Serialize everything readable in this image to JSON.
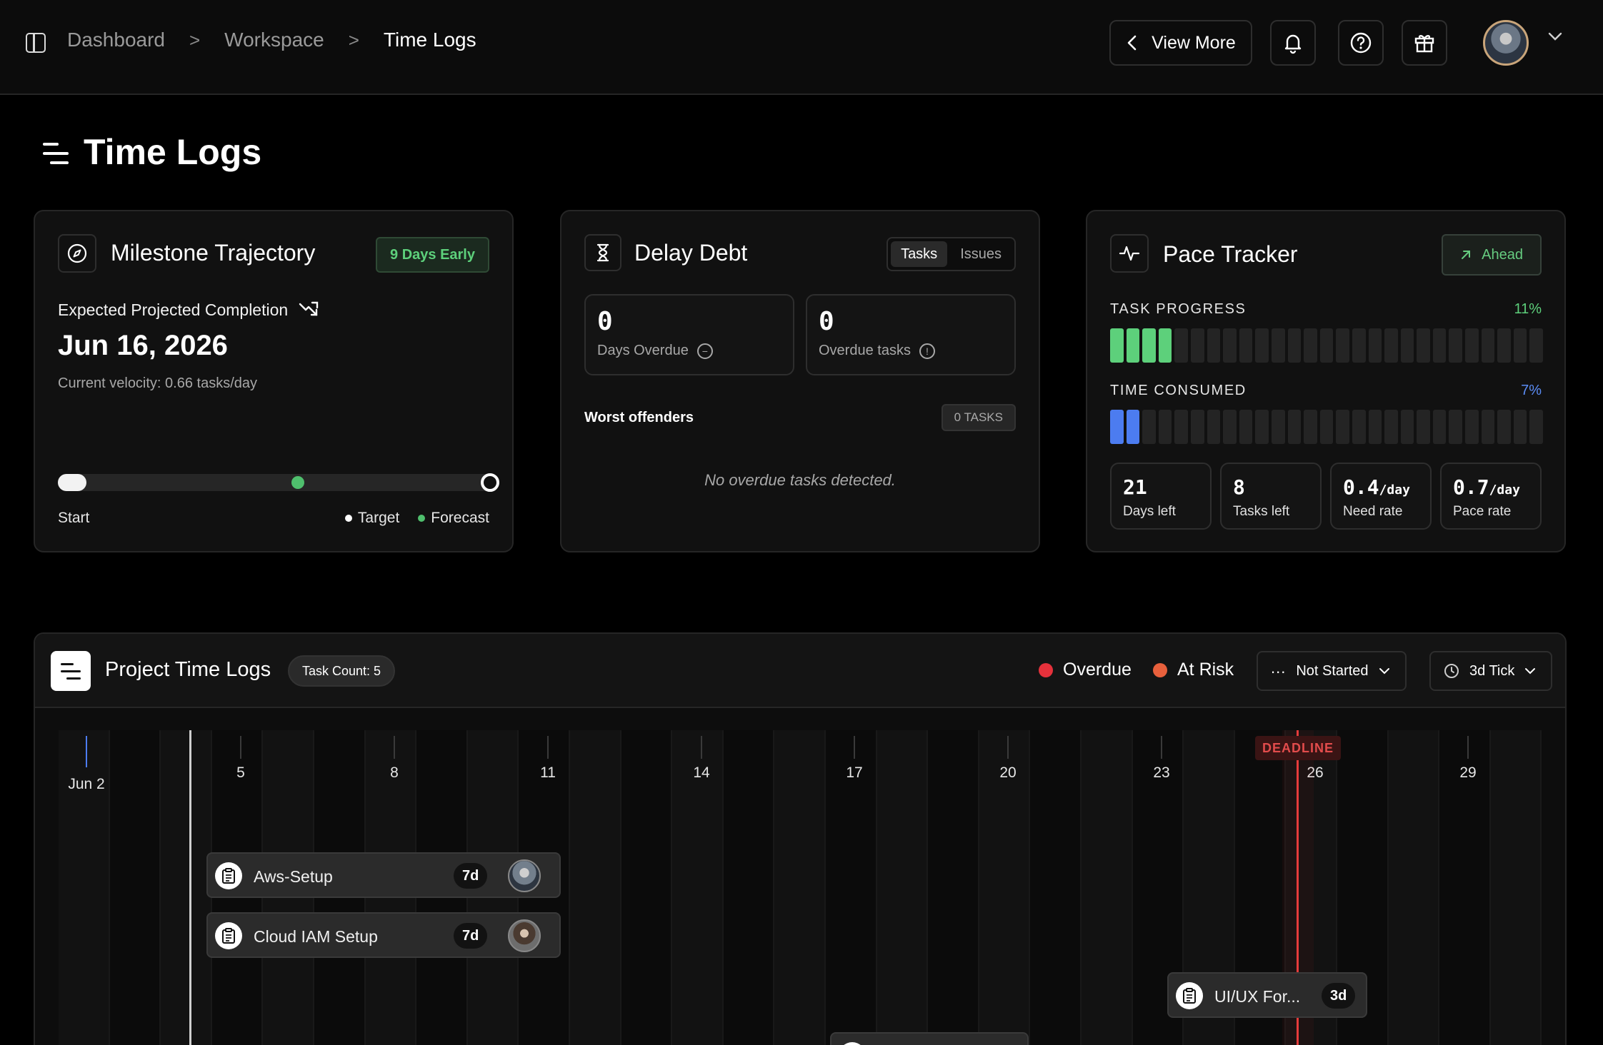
{
  "breadcrumb": {
    "items": [
      "Dashboard",
      "Workspace",
      "Time Logs"
    ],
    "separator": ">"
  },
  "topbar": {
    "view_more_label": "View More",
    "icons": [
      "sidebar-toggle-icon",
      "bell-icon",
      "help-icon",
      "gift-icon",
      "avatar",
      "chevron-down-icon"
    ]
  },
  "page": {
    "title": "Time Logs"
  },
  "milestone": {
    "title": "Milestone Trajectory",
    "badge": "9 Days Early",
    "subtitle": "Expected Projected Completion",
    "date": "Jun 16, 2026",
    "velocity": "Current velocity: 0.66 tasks/day",
    "forecast_position": 0.55,
    "start_label": "Start",
    "target_label": "Target",
    "forecast_label": "Forecast"
  },
  "delay_debt": {
    "title": "Delay Debt",
    "tabs": [
      {
        "label": "Tasks",
        "active": true
      },
      {
        "label": "Issues",
        "active": false
      }
    ],
    "days_overdue_value": "0",
    "days_overdue_label": "Days Overdue",
    "overdue_tasks_value": "0",
    "overdue_tasks_label": "Overdue tasks",
    "worst_offenders_title": "Worst offenders",
    "worst_offenders_badge": "0 TASKS",
    "empty_message": "No overdue tasks detected."
  },
  "pace": {
    "title": "Pace Tracker",
    "status_label": "Ahead",
    "task_progress_label": "TASK PROGRESS",
    "task_progress_pct": "11%",
    "task_progress_value": 0.11,
    "time_consumed_label": "TIME CONSUMED",
    "time_consumed_pct": "7%",
    "time_consumed_value": 0.07,
    "segments": 27,
    "stats": [
      {
        "value": "21",
        "unit": "",
        "label": "Days left"
      },
      {
        "value": "8",
        "unit": "",
        "label": "Tasks left"
      },
      {
        "value": "0.4",
        "unit": "/day",
        "label": "Need rate"
      },
      {
        "value": "0.7",
        "unit": "/day",
        "label": "Pace rate"
      }
    ]
  },
  "project_time_logs": {
    "title": "Project Time Logs",
    "task_count": "Task Count: 5",
    "legend": [
      {
        "label": "Overdue",
        "color": "#e5313b"
      },
      {
        "label": "At Risk",
        "color": "#e8603c"
      }
    ],
    "status_filter": "Not Started",
    "tick_filter": "3d Tick",
    "axis": {
      "first_label": "Jun 2",
      "labels": [
        "5",
        "8",
        "11",
        "14",
        "17",
        "20",
        "23",
        "26",
        "29"
      ],
      "deadline_label": "DEADLINE"
    },
    "tasks": [
      {
        "name": "Aws-Setup",
        "duration": "7d"
      },
      {
        "name": "Cloud IAM Setup",
        "duration": "7d"
      },
      {
        "name": "UI/UX For...",
        "duration": "3d"
      }
    ]
  },
  "colors": {
    "accent_green": "#5dd07b",
    "accent_blue": "#4c7cf0",
    "deadline_red": "#e53b3b"
  }
}
